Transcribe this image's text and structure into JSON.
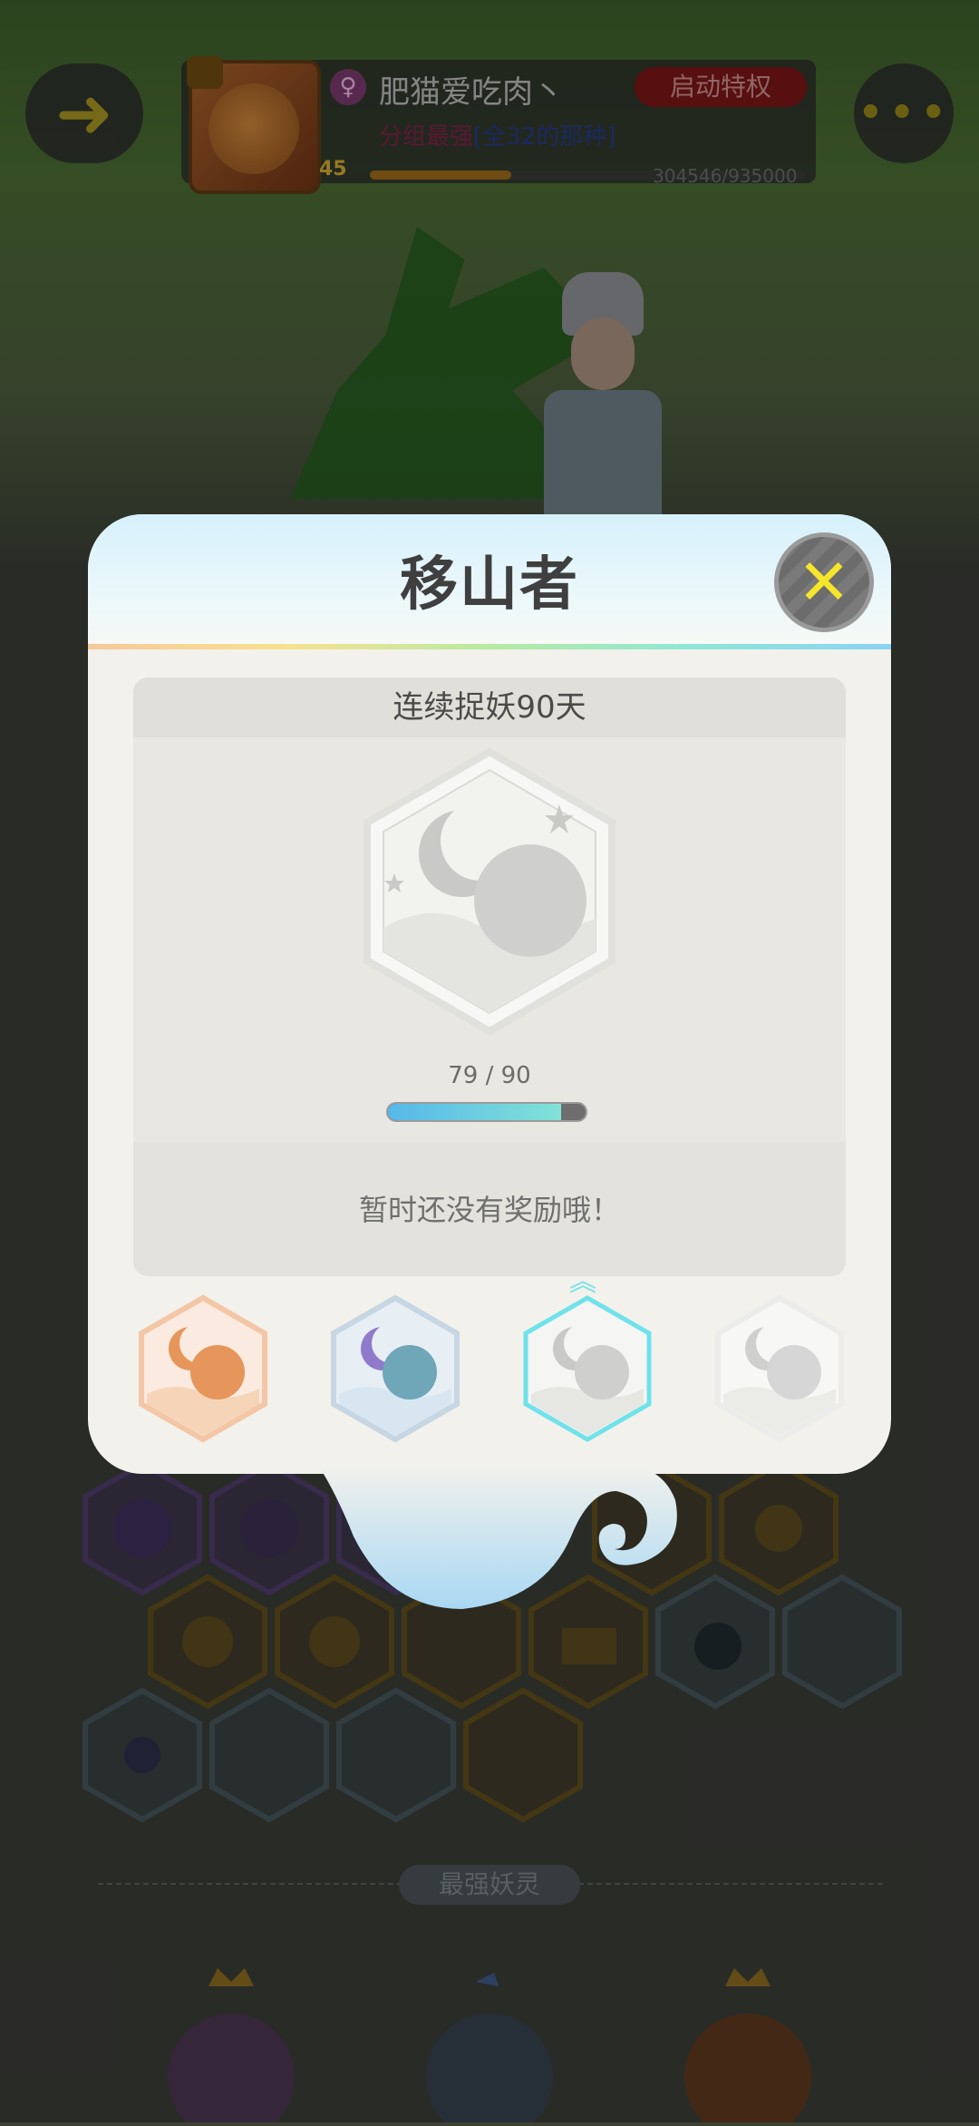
{
  "header": {
    "back_icon": "back-arrow-icon",
    "more_icon": "more-dots-icon",
    "profile": {
      "nickname": "肥猫爱吃肉丶",
      "gender_icon": "female-icon",
      "gender_symbol": "♀",
      "privilege_button": "启动特权",
      "title_prefix": "分组最强",
      "title_suffix": "[全32的那种]",
      "level": "45",
      "exp_text": "304546/935000",
      "exp_progress": 0.326
    }
  },
  "modal": {
    "title": "移山者",
    "close_icon": "close-x-icon",
    "condition": "连续捉妖90天",
    "progress_current": 79,
    "progress_total": 90,
    "progress_text": "79 / 90",
    "reward_text": "暂时还没有奖励哦！",
    "tiers": [
      {
        "tier": "bronze",
        "color": "#e6965a",
        "state": "achieved"
      },
      {
        "tier": "silver",
        "color": "#6fa6b8",
        "state": "achieved"
      },
      {
        "tier": "gold",
        "color": "#cfcfcf",
        "state": "selected"
      },
      {
        "tier": "top",
        "color": "#d6d6d6",
        "state": "locked"
      }
    ]
  },
  "background": {
    "section_label": "最强妖灵"
  },
  "colors": {
    "accent_yellow": "#f5e52b",
    "progress_cyan": "#82e2d8",
    "progress_blue": "#55b8e9",
    "modal_bg": "#f2f1ec"
  }
}
